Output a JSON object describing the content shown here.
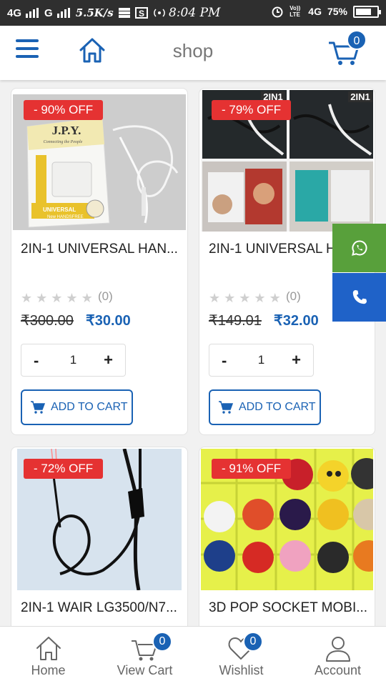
{
  "status_bar": {
    "network_left": "4G",
    "signal_sim2": "G",
    "speed": "5.5K/s",
    "time": "8:04 PM",
    "volte": "Vo)) LTE",
    "network_right": "4G",
    "battery": "75%",
    "battery_level": 0.75
  },
  "header": {
    "title": "shop",
    "cart_count": "0"
  },
  "products": [
    {
      "discount": "- 90% OFF",
      "name": "2IN-1 UNIVERSAL HAN...",
      "stars": 0,
      "rating_count": "(0)",
      "old_price": "₹300.00",
      "new_price": "₹30.00",
      "qty": "1",
      "minus": "-",
      "plus": "+",
      "add_label": "ADD TO CART",
      "image_text": {
        "brand": "J.P.Y.",
        "tagline": "Connecting the People",
        "pack_label": "UNIVERSAL",
        "pack_sub": "New HANDSFREE"
      }
    },
    {
      "discount": "- 79% OFF",
      "name": "2IN-1 UNIVERSAL H",
      "stars": 0,
      "rating_count": "(0)",
      "old_price": "₹149.01",
      "new_price": "₹32.00",
      "qty": "1",
      "minus": "-",
      "plus": "+",
      "add_label": "ADD TO CART",
      "image_text": {
        "tag1": "2IN1",
        "tag2": "2IN1"
      }
    },
    {
      "discount": "- 72% OFF",
      "name": "2IN-1 WAIR LG3500/N7..."
    },
    {
      "discount": "- 91% OFF",
      "name": "3D POP SOCKET MOBI..."
    }
  ],
  "bottom_nav": [
    {
      "label": "Home",
      "icon": "home-icon"
    },
    {
      "label": "View Cart",
      "icon": "cart-icon",
      "badge": "0"
    },
    {
      "label": "Wishlist",
      "icon": "heart-icon",
      "badge": "0"
    },
    {
      "label": "Account",
      "icon": "user-icon"
    }
  ],
  "colors": {
    "accent": "#1a62b4",
    "discount": "#e53232",
    "whatsapp": "#58a03b",
    "phone": "#1f62c8"
  }
}
